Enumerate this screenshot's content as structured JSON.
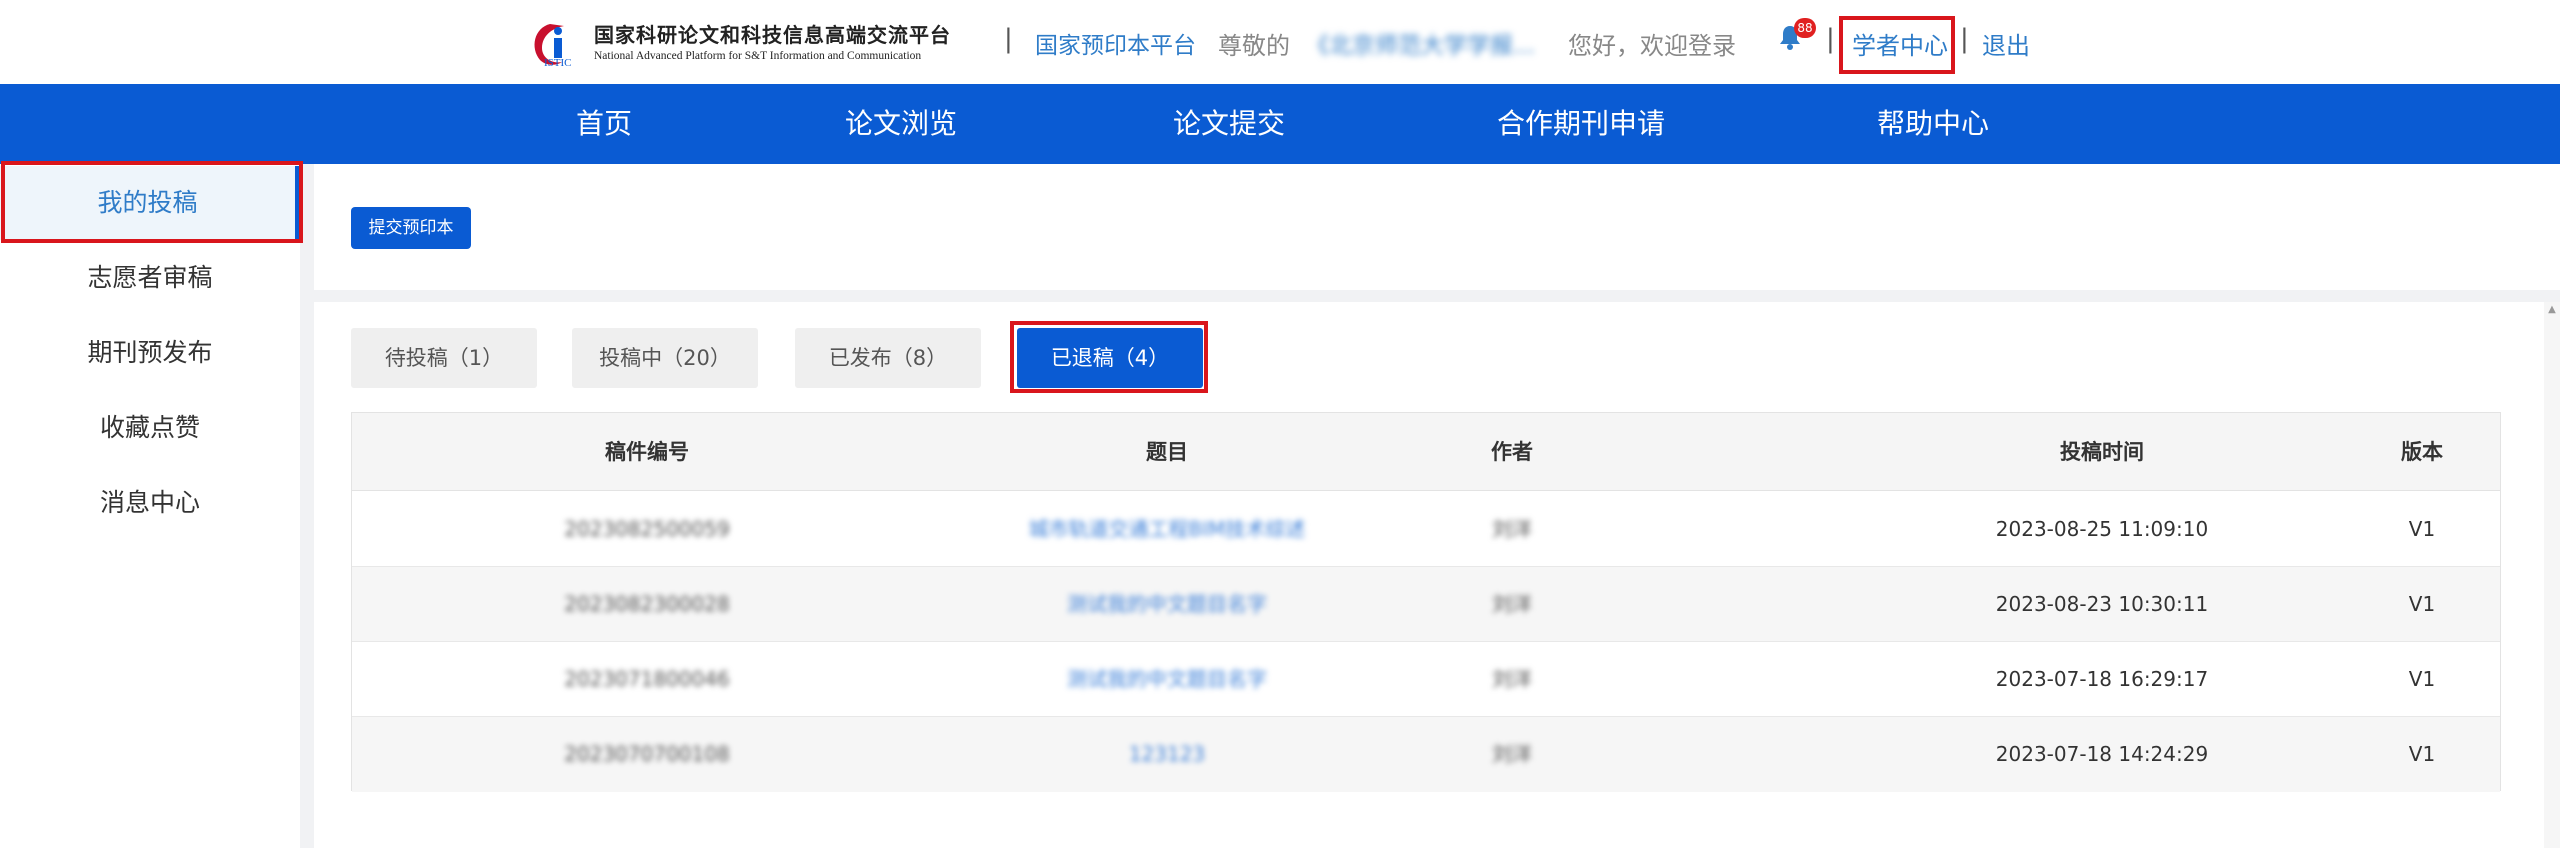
{
  "header": {
    "logo_cn": "国家科研论文和科技信息高端交流平台",
    "logo_en": "National Advanced Platform for S&T Information and Communication",
    "logo_mark": "ISTIC",
    "separator": "|",
    "preprint_platform": "国家预印本平台",
    "greeting_prefix": "尊敬的",
    "institution": "《北京师范大学学报...",
    "welcome": "您好，欢迎登录",
    "notification_count": "88",
    "scholar_center": "学者中心",
    "logout": "退出",
    "bell_icon": "bell-icon"
  },
  "nav": {
    "items": [
      {
        "label": "首页"
      },
      {
        "label": "论文浏览"
      },
      {
        "label": "论文提交"
      },
      {
        "label": "合作期刊申请"
      },
      {
        "label": "帮助中心"
      }
    ]
  },
  "sidebar": {
    "items": [
      {
        "label": "我的投稿",
        "active": true
      },
      {
        "label": "志愿者审稿"
      },
      {
        "label": "期刊预发布"
      },
      {
        "label": "收藏点赞"
      },
      {
        "label": "消息中心"
      }
    ]
  },
  "main": {
    "submit_button": "提交预印本",
    "tabs": [
      {
        "label": "待投稿（1）"
      },
      {
        "label": "投稿中（20）"
      },
      {
        "label": "已发布（8）"
      },
      {
        "label": "已退稿（4）",
        "active": true
      }
    ],
    "table": {
      "columns": [
        "稿件编号",
        "题目",
        "作者",
        "投稿时间",
        "版本"
      ],
      "rows": [
        {
          "id": "2023082500059",
          "title": "城市轨道交通工程BIM技术综述",
          "author": "刘洋",
          "time": "2023-08-25 11:09:10",
          "version": "V1"
        },
        {
          "id": "2023082300028",
          "title": "测试我的中文题目名字",
          "author": "刘洋",
          "time": "2023-08-23 10:30:11",
          "version": "V1"
        },
        {
          "id": "2023071800046",
          "title": "测试我的中文题目名字",
          "author": "刘洋",
          "time": "2023-07-18 16:29:17",
          "version": "V1"
        },
        {
          "id": "2023070700108",
          "title": "123123",
          "author": "刘洋",
          "time": "2023-07-18 14:24:29",
          "version": "V1"
        }
      ]
    }
  },
  "colors": {
    "primary": "#0a5bd3",
    "link": "#2f7cc8",
    "highlight_box": "#d9161c"
  }
}
